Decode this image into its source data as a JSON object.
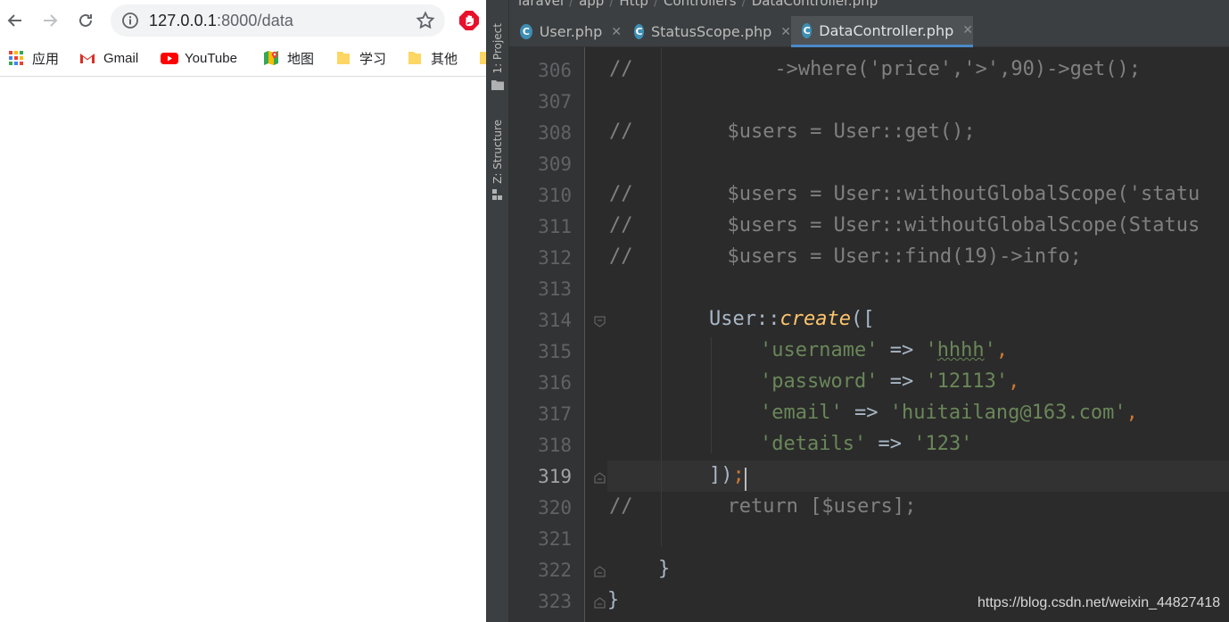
{
  "browser": {
    "url_host": "127.0.0.1",
    "url_path": ":8000/data",
    "bookmarks": [
      {
        "label": "应用",
        "icon": "apps-grid-icon"
      },
      {
        "label": "Gmail",
        "icon": "gmail-icon"
      },
      {
        "label": "YouTube",
        "icon": "youtube-icon"
      },
      {
        "label": "地图",
        "icon": "maps-icon"
      },
      {
        "label": "学习",
        "icon": "folder-icon"
      },
      {
        "label": "其他",
        "icon": "folder-icon"
      }
    ]
  },
  "ide": {
    "breadcrumb": [
      "laravel",
      "app",
      "Http",
      "Controllers",
      "DataController.php"
    ],
    "side_tabs": [
      "1: Project",
      "Z: Structure"
    ],
    "tabs": [
      {
        "label": "User.php",
        "active": false
      },
      {
        "label": "StatusScope.php",
        "active": false
      },
      {
        "label": "DataController.php",
        "active": true
      }
    ],
    "lines": [
      {
        "num": "306",
        "comment": "//",
        "text": "            ->where('price','>',90)->get();"
      },
      {
        "num": "307",
        "comment": "",
        "text": ""
      },
      {
        "num": "308",
        "comment": "//",
        "text": "        $users = User::get();"
      },
      {
        "num": "309",
        "comment": "",
        "text": ""
      },
      {
        "num": "310",
        "comment": "//",
        "text": "        $users = User::withoutGlobalScope('statu"
      },
      {
        "num": "311",
        "comment": "//",
        "text": "        $users = User::withoutGlobalScope(Status"
      },
      {
        "num": "312",
        "comment": "//",
        "text": "        $users = User::find(19)->info;"
      },
      {
        "num": "313",
        "comment": "",
        "text": ""
      },
      {
        "num": "314",
        "comment": "",
        "text": "User::create(["
      },
      {
        "num": "315",
        "comment": "",
        "text": "'username' => 'hhhh',"
      },
      {
        "num": "316",
        "comment": "",
        "text": "'password' => '12113',"
      },
      {
        "num": "317",
        "comment": "",
        "text": "'email' => 'huitailang@163.com',"
      },
      {
        "num": "318",
        "comment": "",
        "text": "'details' => '123'"
      },
      {
        "num": "319",
        "comment": "",
        "text": "]);"
      },
      {
        "num": "320",
        "comment": "//",
        "text": "        return [$users];"
      },
      {
        "num": "321",
        "comment": "",
        "text": ""
      },
      {
        "num": "322",
        "comment": "",
        "text": "}"
      },
      {
        "num": "323",
        "comment": "",
        "text": "}"
      }
    ],
    "current_line": "319"
  },
  "watermark": "https://blog.csdn.net/weixin_44827418",
  "colors": {
    "editor_bg": "#2b2b2b",
    "comment": "#808080",
    "string": "#6a8759",
    "keyword": "#cc7832",
    "function": "#ffc66d",
    "default": "#a9b7c6"
  }
}
